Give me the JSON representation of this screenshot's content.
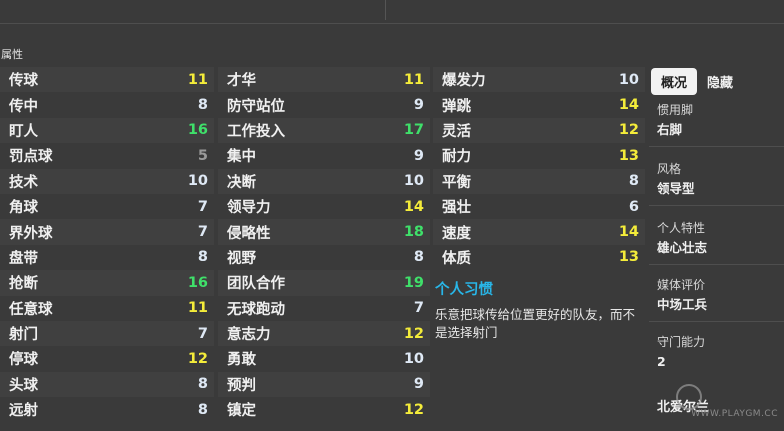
{
  "section_title": "属性",
  "col1": [
    {
      "name": "传球",
      "value": "11",
      "color": "yellow"
    },
    {
      "name": "传中",
      "value": "8",
      "color": "white"
    },
    {
      "name": "盯人",
      "value": "16",
      "color": "green"
    },
    {
      "name": "罚点球",
      "value": "5",
      "color": "grey"
    },
    {
      "name": "技术",
      "value": "10",
      "color": "white"
    },
    {
      "name": "角球",
      "value": "7",
      "color": "white"
    },
    {
      "name": "界外球",
      "value": "7",
      "color": "white"
    },
    {
      "name": "盘带",
      "value": "8",
      "color": "white"
    },
    {
      "name": "抢断",
      "value": "16",
      "color": "green"
    },
    {
      "name": "任意球",
      "value": "11",
      "color": "yellow"
    },
    {
      "name": "射门",
      "value": "7",
      "color": "white"
    },
    {
      "name": "停球",
      "value": "12",
      "color": "yellow"
    },
    {
      "name": "头球",
      "value": "8",
      "color": "white"
    },
    {
      "name": "远射",
      "value": "8",
      "color": "white"
    }
  ],
  "col2": [
    {
      "name": "才华",
      "value": "11",
      "color": "yellow"
    },
    {
      "name": "防守站位",
      "value": "9",
      "color": "white"
    },
    {
      "name": "工作投入",
      "value": "17",
      "color": "green"
    },
    {
      "name": "集中",
      "value": "9",
      "color": "white"
    },
    {
      "name": "决断",
      "value": "10",
      "color": "white"
    },
    {
      "name": "领导力",
      "value": "14",
      "color": "yellow"
    },
    {
      "name": "侵略性",
      "value": "18",
      "color": "green"
    },
    {
      "name": "视野",
      "value": "8",
      "color": "white"
    },
    {
      "name": "团队合作",
      "value": "19",
      "color": "green"
    },
    {
      "name": "无球跑动",
      "value": "7",
      "color": "white"
    },
    {
      "name": "意志力",
      "value": "12",
      "color": "yellow"
    },
    {
      "name": "勇敢",
      "value": "10",
      "color": "white"
    },
    {
      "name": "预判",
      "value": "9",
      "color": "white"
    },
    {
      "name": "镇定",
      "value": "12",
      "color": "yellow"
    }
  ],
  "col3": [
    {
      "name": "爆发力",
      "value": "10",
      "color": "white"
    },
    {
      "name": "弹跳",
      "value": "14",
      "color": "yellow"
    },
    {
      "name": "灵活",
      "value": "12",
      "color": "yellow"
    },
    {
      "name": "耐力",
      "value": "13",
      "color": "yellow"
    },
    {
      "name": "平衡",
      "value": "8",
      "color": "white"
    },
    {
      "name": "强壮",
      "value": "6",
      "color": "white"
    },
    {
      "name": "速度",
      "value": "14",
      "color": "yellow"
    },
    {
      "name": "体质",
      "value": "13",
      "color": "yellow"
    }
  ],
  "habit": {
    "title": "个人习惯",
    "text": "乐意把球传给位置更好的队友，而不是选择射门"
  },
  "side": {
    "tabs": [
      {
        "label": "概况",
        "active": true
      },
      {
        "label": "隐藏",
        "active": false
      }
    ],
    "info": [
      {
        "label": "惯用脚",
        "value": "右脚"
      },
      {
        "label": "风格",
        "value": "领导型"
      },
      {
        "label": "个人特性",
        "value": "雄心壮志"
      },
      {
        "label": "媒体评价",
        "value": "中场工兵"
      },
      {
        "label": "守门能力",
        "value": "2"
      }
    ],
    "bottom_text": "北爱尔兰",
    "watermark": "WWW.PLAYGM.CC"
  },
  "colors": {
    "white": "#dfe9f5",
    "yellow": "#f4ec3a",
    "green": "#3fe06a",
    "grey": "#9a9a9a",
    "habit_title": "#28b6e8"
  }
}
